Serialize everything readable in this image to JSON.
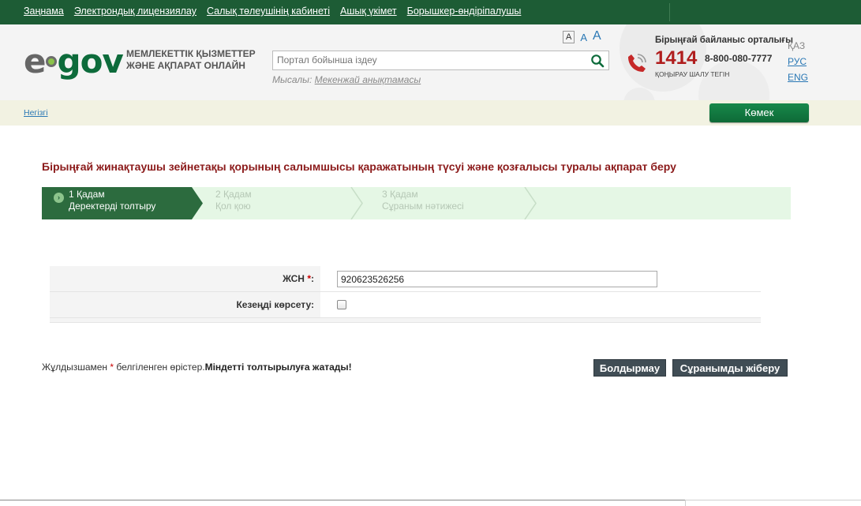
{
  "topnav": {
    "links": [
      "Заңнама",
      "Электрондық лицензиялау",
      "Салық төлеушінің кабинеті",
      "Ашық үкімет",
      "Борышкер-өндіріпалушы"
    ]
  },
  "header": {
    "logo_e": "e",
    "logo_gov": "gov",
    "tagline_line1": "МЕМЛЕКЕТТІК ҚЫЗМЕТТЕР",
    "tagline_line2": "ЖӘНЕ АҚПАРАТ ОНЛАЙН",
    "font_sizes": [
      "A",
      "A",
      "A"
    ],
    "search_placeholder": "Портал бойынша іздеу",
    "example_prefix": "Мысалы:",
    "example_link": "Мекенжай анықтамасы",
    "contact_title": "Бірыңғай байланыс орталығы",
    "hotline": "1414",
    "phone": "8-800-080-7777",
    "call_free": "ҚОҢЫРАУ ШАЛУ ТЕГІН",
    "languages": {
      "current": "ҚАЗ",
      "ru": "РУС",
      "en": "ENG"
    }
  },
  "breadcrumb": {
    "home": "Негізгі"
  },
  "help_button": "Көмек",
  "page_title": "Бірыңғай жинақтаушы зейнетақы қорының салымшысы қаражатының түсуі және қозғалысы туралы ақпарат беру",
  "steps": [
    {
      "num": "1 Қадам",
      "label": "Деректерді толтыру",
      "active": true
    },
    {
      "num": "2 Қадам",
      "label": "Қол қою",
      "active": false
    },
    {
      "num": "3 Қадам",
      "label": "Сұраным нәтижесі",
      "active": false
    }
  ],
  "form": {
    "iin_label": "ЖСН",
    "iin_required": "*",
    "iin_colon": ":",
    "iin_value": "920623526256",
    "period_label": "Кезеңді көрсету:",
    "period_checked": false
  },
  "note": {
    "part1": "Жұлдызшамен ",
    "star": "*",
    "part2": " белгіленген өрістер.",
    "bold": "Міндетті толтырылуға жатады!"
  },
  "buttons": {
    "cancel": "Болдырмау",
    "submit": "Сұранымды жіберу"
  },
  "colors": {
    "nav_green": "#1d5c35",
    "title_red": "#8b1a1a",
    "step_bg": "#e5f7e5",
    "button_dark": "#404d55"
  }
}
